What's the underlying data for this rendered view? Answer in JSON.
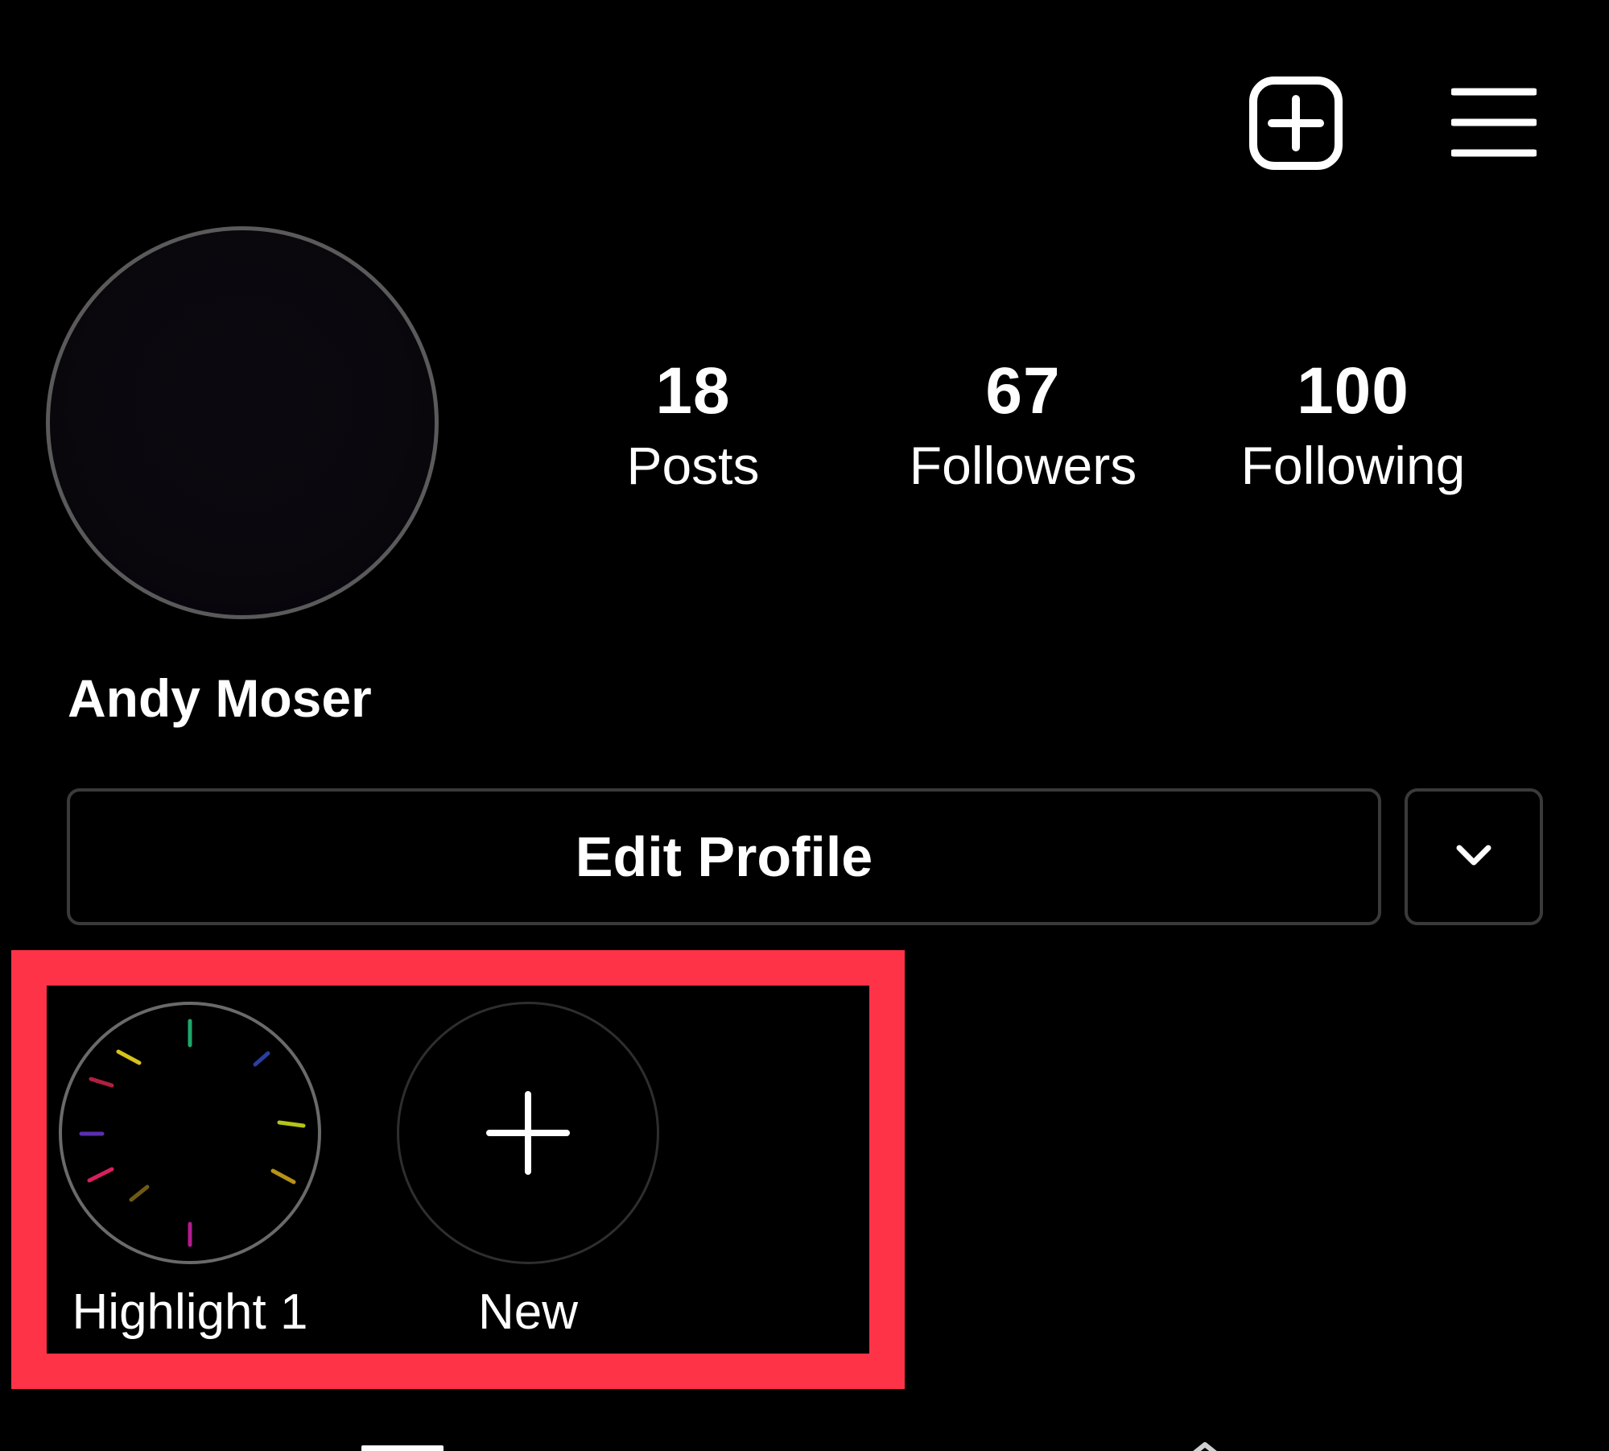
{
  "header": {
    "icons": [
      "new-post-icon",
      "menu-icon"
    ]
  },
  "profile": {
    "display_name": "Andy Moser",
    "stats": [
      {
        "value": "18",
        "label": "Posts"
      },
      {
        "value": "67",
        "label": "Followers"
      },
      {
        "value": "100",
        "label": "Following"
      }
    ],
    "edit_button_label": "Edit Profile"
  },
  "highlights": [
    {
      "label": "Highlight 1"
    },
    {
      "label": "New"
    }
  ],
  "colors": {
    "background": "#000000",
    "text": "#ffffff",
    "button_border": "#3a3a3a",
    "annotation_frame": "#ff3347"
  }
}
